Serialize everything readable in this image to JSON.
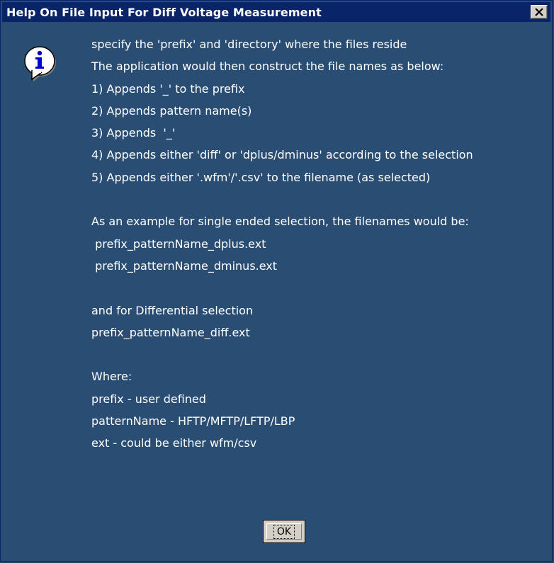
{
  "window": {
    "title": "Help On File Input For Diff Voltage Measurement",
    "close_glyph": "✕"
  },
  "icons": {
    "message_icon": "info-icon",
    "close_icon": "close-icon"
  },
  "colors": {
    "title_bar": "#0a246a",
    "content_background": "#2a4d73",
    "text": "#ffffff",
    "button_face": "#d4d0c8"
  },
  "message": {
    "lines": [
      "specify the 'prefix' and 'directory' where the files reside",
      "The application would then construct the file names as below:",
      "1) Appends '_' to the prefix",
      "2) Appends pattern name(s)",
      "3) Appends  '_'",
      "4) Appends either 'diff' or 'dplus/dminus' according to the selection",
      "5) Appends either '.wfm'/'.csv' to the filename (as selected)",
      "",
      "As an example for single ended selection, the filenames would be:",
      " prefix_patternName_dplus.ext",
      " prefix_patternName_dminus.ext",
      "",
      "and for Differential selection",
      "prefix_patternName_diff.ext",
      "",
      "Where:",
      "prefix - user defined",
      "patternName - HFTP/MFTP/LFTP/LBP",
      "ext - could be either wfm/csv"
    ]
  },
  "buttons": {
    "ok_label": "OK"
  }
}
